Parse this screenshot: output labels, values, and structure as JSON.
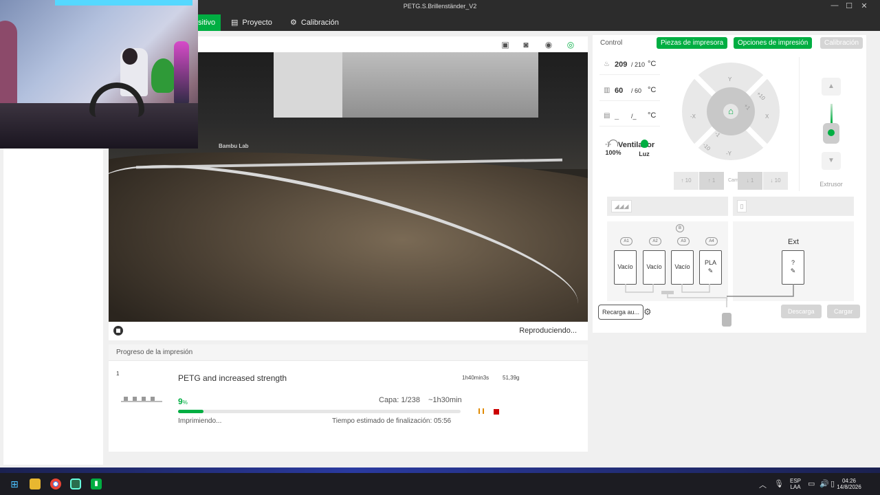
{
  "window": {
    "title": "PETG.S.Brillenständer_V2",
    "controls": [
      "—",
      "☐",
      "✕"
    ]
  },
  "menu": {
    "tabs": [
      {
        "label": "sitivo",
        "icon": "device-icon"
      },
      {
        "label": "Proyecto",
        "icon": "project-icon"
      },
      {
        "label": "Calibración",
        "icon": "calibration-icon"
      }
    ]
  },
  "video": {
    "status": "Reproduciendo...",
    "overlay_text": "Bambu Lab"
  },
  "progress": {
    "header": "Progreso de la impresión",
    "plate": "1",
    "job_name": "PETG and increased strength",
    "total_time": "1h40min3s",
    "weight": "51,39g",
    "percent": "9",
    "percent_unit": "%",
    "percent_value": 9,
    "layer": "Capa: 1/238",
    "remaining": "~1h30min",
    "status": "Imprimiendo...",
    "eta": "Tiempo estimado de finalización: 05:56"
  },
  "control": {
    "title": "Control",
    "buttons": {
      "parts": "Piezas de impresora",
      "options": "Opciones de impresión",
      "calibration": "Calibración"
    },
    "nozzle": {
      "current": "209",
      "target": "/ 210",
      "unit": "°C"
    },
    "bed": {
      "current": "60",
      "target": "/ 60",
      "unit": "°C"
    },
    "chamber": {
      "current": "_",
      "target": "/_",
      "unit": "°C"
    },
    "fan_label": "Ventilador",
    "speed": "100%",
    "light": "Luz",
    "jog": {
      "y_pos": "Y",
      "y_neg": "-Y",
      "x_pos": "X",
      "x_neg": "-X",
      "p10": "+10",
      "p1": "+1",
      "m1": "-1",
      "m10": "-10"
    },
    "bed_controls": {
      "up10": "10",
      "up1": "1",
      "label": "Cama",
      "down1": "1",
      "down10": "10"
    },
    "extruder_label": "Extrusor"
  },
  "ams": {
    "slots": [
      {
        "id": "A1",
        "label": "Vacío"
      },
      {
        "id": "A2",
        "label": "Vacío"
      },
      {
        "id": "A3",
        "label": "Vacío"
      },
      {
        "id": "A4",
        "label": "PLA"
      }
    ],
    "ext_title": "Ext",
    "ext_slot": "?",
    "info_badge": "B",
    "reload_button": "Recarga au...",
    "unload_button": "Descarga",
    "load_button": "Cargar"
  },
  "taskbar": {
    "lang_top": "ESP",
    "lang_bottom": "LAA",
    "time": "04:26",
    "date": "14/8/2026"
  }
}
